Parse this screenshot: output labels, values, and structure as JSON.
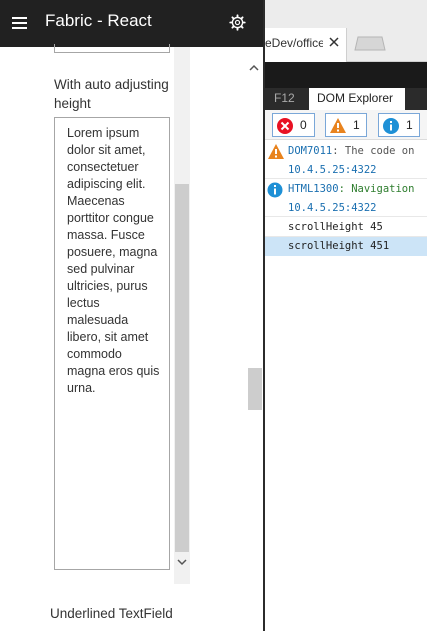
{
  "app": {
    "title": "Fabric - React",
    "auto_label": "With auto adjusting height",
    "textarea_value": "Lorem ipsum dolor sit amet, consectetuer adipiscing elit. Maecenas porttitor congue massa. Fusce posuere, magna sed pulvinar ultricies, purus lectus malesuada libero, sit amet commodo magna eros quis urna.",
    "underlined_label": "Underlined TextField"
  },
  "browser": {
    "tab_label": "eDev/office",
    "devtools": {
      "f12_label": "F12",
      "active_tool": "DOM Explorer",
      "filters": {
        "errors": "0",
        "warnings": "1",
        "messages": "1"
      },
      "console": [
        {
          "kind": "warning",
          "code": "DOM7011",
          "text": ": The code on",
          "source": "10.4.5.25:4322"
        },
        {
          "kind": "info",
          "code": "HTML1300",
          "text": ": Navigation",
          "source": "10.4.5.25:4322"
        },
        {
          "kind": "log",
          "text": "scrollHeight 45"
        },
        {
          "kind": "log",
          "text": "scrollHeight 451"
        }
      ]
    }
  },
  "colors": {
    "header_bg": "#212121",
    "selected_row": "#cce4f7",
    "error": "#e81123",
    "warning": "#e8831e",
    "info": "#1e90d6"
  }
}
